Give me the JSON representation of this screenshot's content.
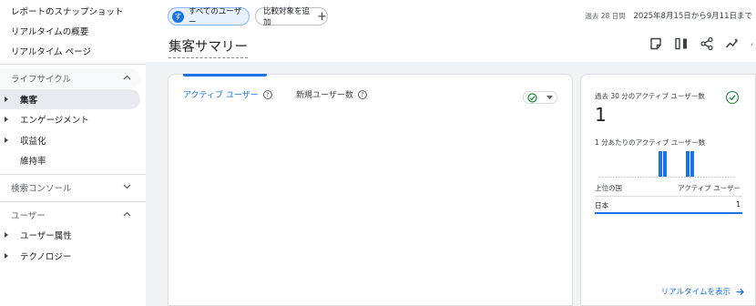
{
  "sidebar": {
    "top_items": [
      {
        "label": "レポートのスナップショット"
      },
      {
        "label": "リアルタイムの概要"
      },
      {
        "label": "リアルタイム ページ"
      }
    ],
    "lifecycle": {
      "title": "ライフサイクル",
      "items": [
        {
          "label": "集客",
          "active": true,
          "expandable": true
        },
        {
          "label": "エンゲージメント",
          "expandable": true
        },
        {
          "label": "収益化",
          "expandable": true
        },
        {
          "label": "維持率",
          "expandable": false
        }
      ]
    },
    "search_console": {
      "title": "検索コンソール"
    },
    "user": {
      "title": "ユーザー",
      "items": [
        {
          "label": "ユーザー属性"
        },
        {
          "label": "テクノロジー"
        }
      ]
    }
  },
  "header": {
    "all_users_chip": "すべてのユーザー",
    "all_users_badge": "す",
    "add_comparison": "比較対象を追加",
    "date_label": "過去 28 日間",
    "date_range": "2025年8月15日から9月11日まで",
    "title": "集客サマリー"
  },
  "main_card": {
    "tab_active": "アクティブ ユーザー",
    "tab_inactive": "新規ユーザー数",
    "help_glyph": "?"
  },
  "realtime_card": {
    "label": "過去 30 分のアクティブ ユーザー数",
    "value": "1",
    "per_minute_label": "1 分あたりのアクティブ ユーザー数",
    "table_header_left": "上位の国",
    "table_header_right": "アクティブ ユーザー",
    "row_country": "日本",
    "row_value": "1",
    "link": "リアルタイムを表示"
  },
  "colors": {
    "accent": "#1a73e8",
    "success": "#188038"
  }
}
